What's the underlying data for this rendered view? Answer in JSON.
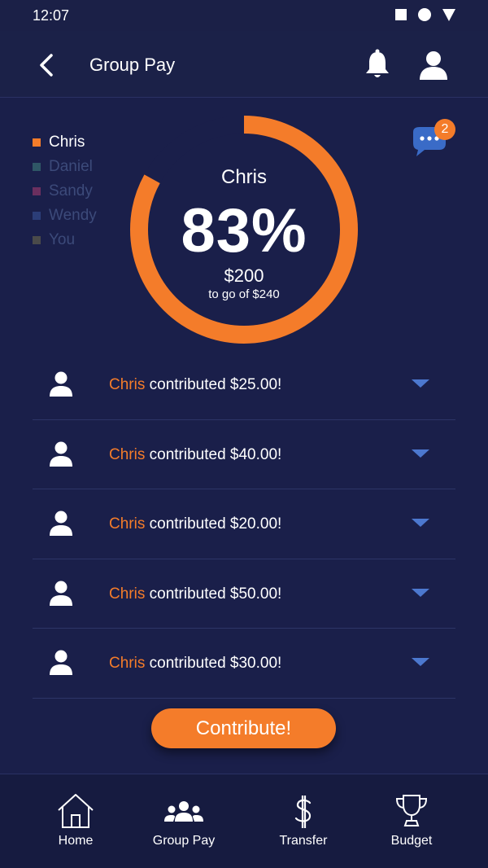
{
  "status_bar": {
    "time": "12:07"
  },
  "header": {
    "title": "Group Pay"
  },
  "colors": {
    "accent": "#f47c2a",
    "background": "#1a1f4a",
    "chevron": "#4c78cf"
  },
  "legend": [
    {
      "label": "Chris",
      "color": "#f47c2a",
      "text_color": "#ffffff"
    },
    {
      "label": "Daniel",
      "color": "#2f5766",
      "text_color": "#3c4a7a"
    },
    {
      "label": "Sandy",
      "color": "#6b2f5f",
      "text_color": "#3c4a7a"
    },
    {
      "label": "Wendy",
      "color": "#2b3d78",
      "text_color": "#3c4a7a"
    },
    {
      "label": "You",
      "color": "#4a4a4a",
      "text_color": "#3c4a7a"
    }
  ],
  "chat": {
    "badge_count": "2"
  },
  "progress": {
    "name": "Chris",
    "percent_label": "83%",
    "fraction": 0.83,
    "amount": "$200",
    "subtitle": "to go of $240"
  },
  "contributions": [
    {
      "name": "Chris",
      "text": " contributed $25.00!"
    },
    {
      "name": "Chris",
      "text": " contributed $40.00!"
    },
    {
      "name": "Chris",
      "text": " contributed $20.00!"
    },
    {
      "name": "Chris",
      "text": " contributed $50.00!"
    },
    {
      "name": "Chris",
      "text": " contributed $30.00!"
    }
  ],
  "contribute_button": {
    "label": "Contribute!"
  },
  "tabs": [
    {
      "label": "Home",
      "icon": "home-icon"
    },
    {
      "label": "Group Pay",
      "icon": "group-icon"
    },
    {
      "label": "Transfer",
      "icon": "dollar-icon"
    },
    {
      "label": "Budget",
      "icon": "trophy-icon"
    }
  ]
}
